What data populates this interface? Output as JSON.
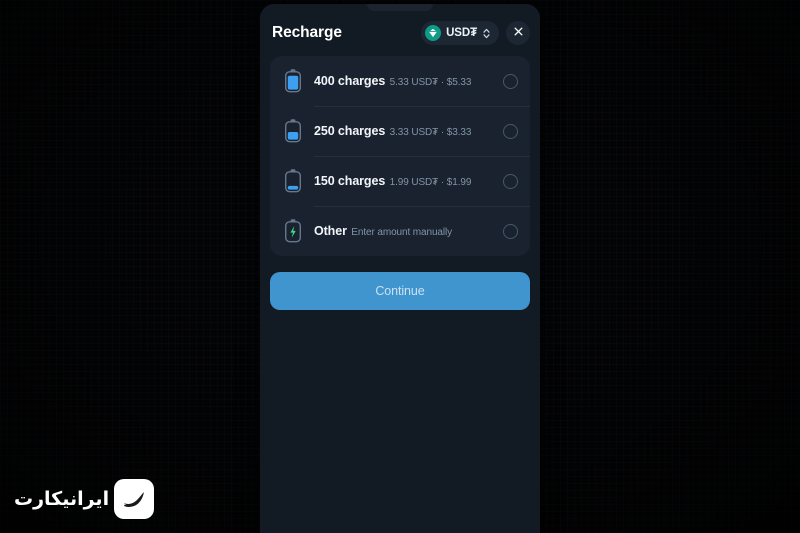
{
  "header": {
    "title": "Recharge",
    "currency": {
      "label": "USD₮",
      "icon": "tether-diamond-icon",
      "selector_icon": "chevron-up-down-icon"
    },
    "close_icon": "close-icon"
  },
  "options": [
    {
      "title": "400 charges",
      "subtitle": "5.33 USD₮ · $5.33",
      "icon": "battery-full-icon",
      "fill_percent": 88,
      "fill_color": "#3d9ff0",
      "selected": false
    },
    {
      "title": "250 charges",
      "subtitle": "3.33 USD₮ · $3.33",
      "icon": "battery-half-icon",
      "fill_percent": 48,
      "fill_color": "#3d9ff0",
      "selected": false
    },
    {
      "title": "150 charges",
      "subtitle": "1.99 USD₮ · $1.99",
      "icon": "battery-low-icon",
      "fill_percent": 24,
      "fill_color": "#3d9ff0",
      "selected": false
    },
    {
      "title": "Other",
      "subtitle": "Enter amount manually",
      "icon": "battery-bolt-icon",
      "fill_percent": 0,
      "fill_color": "#3ddc84",
      "selected": false
    }
  ],
  "continue_button": {
    "label": "Continue",
    "color": "#4095cf",
    "enabled": false
  },
  "watermark": {
    "text": "ایرانیکارت",
    "mark_icon": "iranicard-logo-icon"
  },
  "colors": {
    "panel_background": "#121a24",
    "card_background": "#19222e",
    "accent_blue": "#3d9ff0",
    "accent_green": "#3ddc84",
    "tether_teal": "#0f9b87",
    "button_blue": "#4095cf",
    "title_text": "#ffffff",
    "subtitle_text": "#8294a8"
  }
}
